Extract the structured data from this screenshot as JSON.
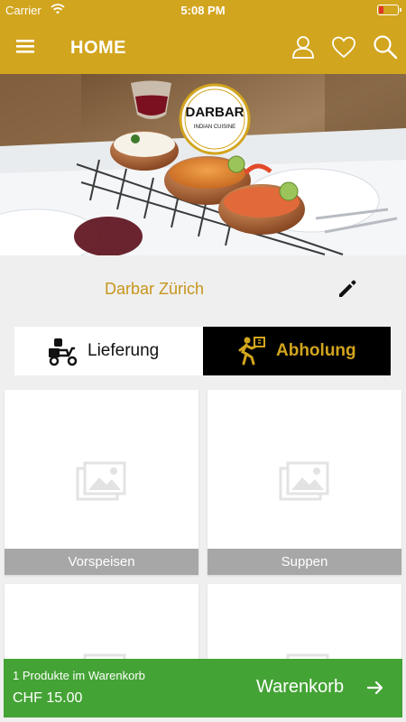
{
  "status_bar": {
    "carrier": "Carrier",
    "time": "5:08 PM"
  },
  "app_bar": {
    "title": "HOME",
    "icons": [
      "menu-icon",
      "user-icon",
      "heart-icon",
      "search-icon"
    ]
  },
  "hero": {
    "logo_text": "DARBAR",
    "logo_subtext": "INDIAN CUISINE"
  },
  "store": {
    "name": "Darbar Zürich"
  },
  "order_modes": [
    {
      "label": "Lieferung",
      "icon": "delivery-scooter-icon",
      "selected": false
    },
    {
      "label": "Abholung",
      "icon": "pickup-person-icon",
      "selected": true
    }
  ],
  "categories": [
    {
      "label": "Vorspeisen"
    },
    {
      "label": "Suppen"
    },
    {
      "label": ""
    },
    {
      "label": ""
    }
  ],
  "cart": {
    "count_text": "1 Produkte im Warenkorb",
    "total": "CHF 15.00",
    "button_label": "Warenkorb"
  },
  "colors": {
    "brand_gold": "#d2a51e",
    "store_name": "#c7951d",
    "cart_green": "#44a335",
    "selected_mode_bg": "#000000",
    "category_caption_bg": "#a7a7a7"
  }
}
